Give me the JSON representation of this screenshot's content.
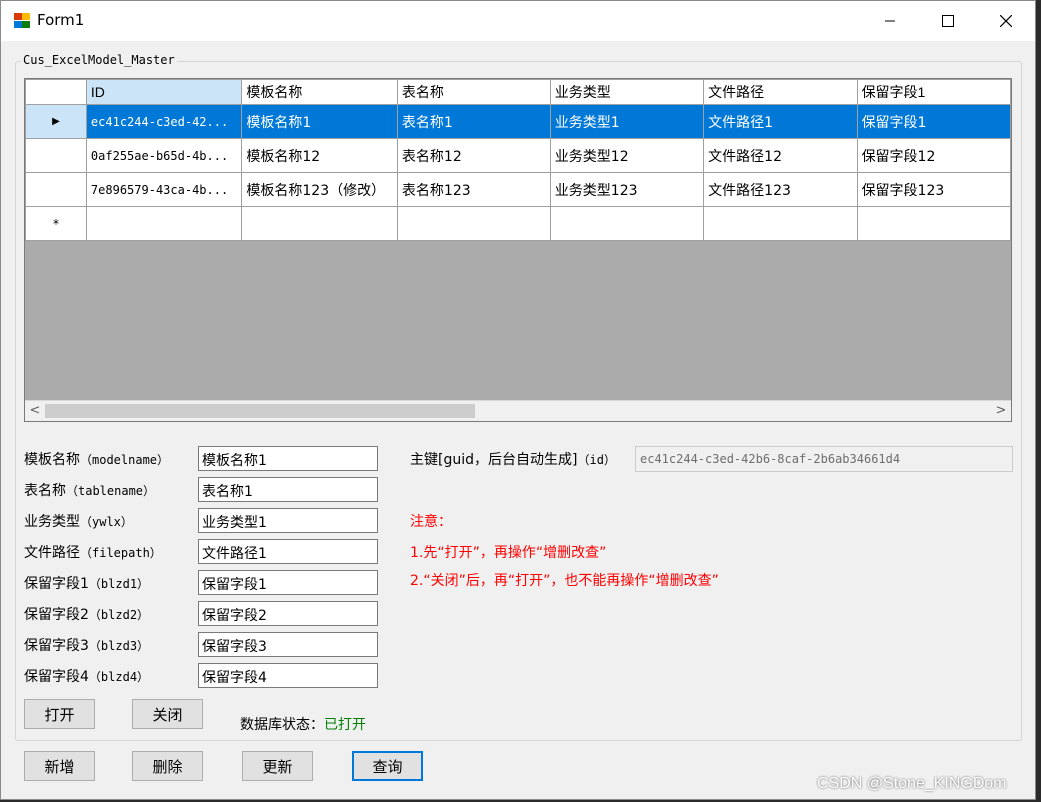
{
  "window": {
    "title": "Form1"
  },
  "group": {
    "label": "Cus_ExcelModel_Master"
  },
  "grid": {
    "columns": [
      "ID",
      "模板名称",
      "表名称",
      "业务类型",
      "文件路径",
      "保留字段1"
    ],
    "rows": [
      [
        "ec41c244-c3ed-42...",
        "模板名称1",
        "表名称1",
        "业务类型1",
        "文件路径1",
        "保留字段1"
      ],
      [
        "0af255ae-b65d-4b...",
        "模板名称12",
        "表名称12",
        "业务类型12",
        "文件路径12",
        "保留字段12"
      ],
      [
        "7e896579-43ca-4b...",
        "模板名称123（修改）",
        "表名称123",
        "业务类型123",
        "文件路径123",
        "保留字段123"
      ]
    ],
    "selected_row": 0,
    "new_row_marker": "*",
    "current_row_marker": "▶"
  },
  "form": {
    "fields": [
      {
        "label": "模板名称",
        "key": "（modelname）",
        "value": "模板名称1"
      },
      {
        "label": "表名称",
        "key": "（tablename）",
        "value": "表名称1"
      },
      {
        "label": "业务类型",
        "key": "（ywlx）",
        "value": "业务类型1"
      },
      {
        "label": "文件路径",
        "key": "（filepath）",
        "value": "文件路径1"
      },
      {
        "label": "保留字段1",
        "key": "（blzd1）",
        "value": "保留字段1"
      },
      {
        "label": "保留字段2",
        "key": "（blzd2）",
        "value": "保留字段2"
      },
      {
        "label": "保留字段3",
        "key": "（blzd3）",
        "value": "保留字段3"
      },
      {
        "label": "保留字段4",
        "key": "（blzd4）",
        "value": "保留字段4"
      }
    ],
    "id_label_main": "主键[guid，后台自动生成]",
    "id_label_key": "（id）",
    "id_value": "ec41c244-c3ed-42b6-8caf-2b6ab34661d4"
  },
  "notes": {
    "title": "注意：",
    "line1": "1.先“打开”，再操作“增删改查”",
    "line2": "2.“关闭”后，再“打开”，也不能再操作“增删改查”"
  },
  "buttons": {
    "open": "打开",
    "close": "关闭",
    "add": "新增",
    "delete": "删除",
    "update": "更新",
    "query": "查询"
  },
  "status": {
    "label": "数据库状态：",
    "value": "已打开",
    "value_color": "#008000"
  },
  "watermark": "CSDN @Stone_KINGDom"
}
